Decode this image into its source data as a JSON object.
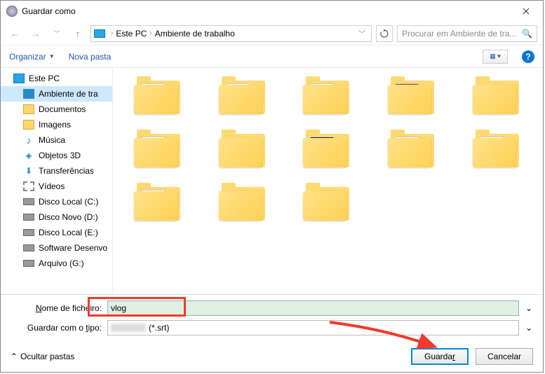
{
  "window": {
    "title": "Guardar como"
  },
  "breadcrumb": {
    "root": "Este PC",
    "folder": "Ambiente de trabalho"
  },
  "search": {
    "placeholder": "Procurar em Ambiente de tra..."
  },
  "toolbar": {
    "organize": "Organizar",
    "new_folder": "Nova pasta"
  },
  "sidebar": {
    "root": "Este PC",
    "items": [
      {
        "label": "Ambiente de tra",
        "selected": true,
        "icon": "monitor"
      },
      {
        "label": "Documentos",
        "icon": "folder"
      },
      {
        "label": "Imagens",
        "icon": "folder"
      },
      {
        "label": "Música",
        "icon": "music"
      },
      {
        "label": "Objetos 3D",
        "icon": "cube"
      },
      {
        "label": "Transferências",
        "icon": "down"
      },
      {
        "label": "Vídeos",
        "icon": "video"
      },
      {
        "label": "Disco Local (C:)",
        "icon": "disk"
      },
      {
        "label": "Disco Novo (D:)",
        "icon": "disk"
      },
      {
        "label": "Disco Local (E:)",
        "icon": "disk"
      },
      {
        "label": "Software Desenvo",
        "icon": "disk"
      },
      {
        "label": "Arquivo (G:)",
        "icon": "disk"
      }
    ]
  },
  "content": {
    "folders": [
      {
        "thumb": "epdf"
      },
      {
        "thumb": "doc"
      },
      {
        "thumb": "doc"
      },
      {
        "thumb": "img"
      },
      {
        "thumb": "plain"
      },
      {
        "thumb": "doc"
      },
      {
        "thumb": "plain"
      },
      {
        "thumb": "dark"
      },
      {
        "thumb": "epdf"
      },
      {
        "thumb": "abg"
      },
      {
        "thumb": "doc"
      },
      {
        "thumb": "plain"
      },
      {
        "thumb": "plain"
      }
    ]
  },
  "bottombar": {
    "filename_label": "Nome de ficheiro:",
    "filename_value": "vlog",
    "filetype_label": "Guardar com o tipo:",
    "filetype_value": "(*.srt)"
  },
  "footer": {
    "hide_folders": "Ocultar pastas",
    "save": "Guardar",
    "cancel": "Cancelar"
  }
}
